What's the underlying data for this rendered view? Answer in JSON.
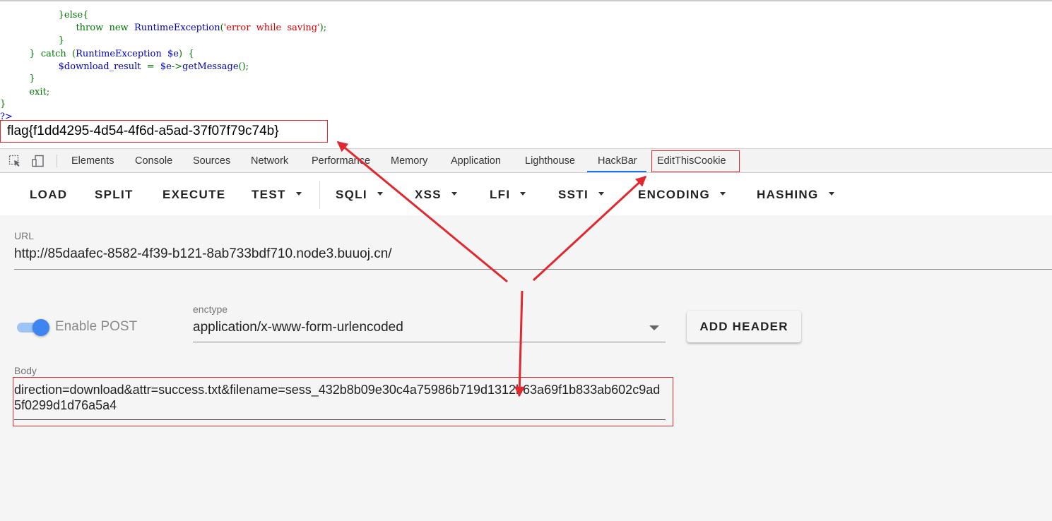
{
  "code": {
    "lines": [
      {
        "indent": "                    ",
        "text": "}else{",
        "color": "green"
      },
      {
        "indent": "                          ",
        "tokens": [
          {
            "t": "throw",
            "c": "green"
          },
          {
            "t": "  ",
            "c": "green"
          },
          {
            "t": "new",
            "c": "green"
          },
          {
            "t": "  ",
            "c": "green"
          },
          {
            "t": "RuntimeException",
            "c": "blue"
          },
          {
            "t": "(",
            "c": "green"
          },
          {
            "t": "'error  while  saving'",
            "c": "red"
          },
          {
            "t": ");",
            "c": "green"
          }
        ]
      },
      {
        "indent": "                    ",
        "text": "}",
        "color": "green"
      },
      {
        "indent": "          ",
        "tokens": [
          {
            "t": "}  catch  (",
            "c": "green"
          },
          {
            "t": "RuntimeException  $e",
            "c": "blue"
          },
          {
            "t": ")  {",
            "c": "green"
          }
        ]
      },
      {
        "indent": "                    ",
        "tokens": [
          {
            "t": "$download_result",
            "c": "blue"
          },
          {
            "t": "  =  ",
            "c": "green"
          },
          {
            "t": "$e",
            "c": "blue"
          },
          {
            "t": "->",
            "c": "green"
          },
          {
            "t": "getMessage",
            "c": "blue"
          },
          {
            "t": "();",
            "c": "green"
          }
        ]
      },
      {
        "indent": "          ",
        "text": "}",
        "color": "green"
      },
      {
        "indent": "          ",
        "text": "exit;",
        "color": "green"
      },
      {
        "indent": "",
        "text": "}",
        "color": "green"
      },
      {
        "indent": "",
        "text": "?>",
        "color": "blue"
      }
    ],
    "flag": "flag{f1dd4295-4d54-4f6d-a5ad-37f07f79c74b}"
  },
  "devtools": {
    "tabs": [
      "Elements",
      "Console",
      "Sources",
      "Network",
      "Performance",
      "Memory",
      "Application",
      "Lighthouse",
      "HackBar",
      "EditThisCookie"
    ],
    "active_tab": "HackBar",
    "icons": [
      "inspect-element-icon",
      "device-toolbar-icon"
    ]
  },
  "hackbar": {
    "toolbar": {
      "load": "LOAD",
      "split": "SPLIT",
      "execute": "EXECUTE",
      "test": "TEST",
      "sqli": "SQLI",
      "xss": "XSS",
      "lfi": "LFI",
      "ssti": "SSTI",
      "encoding": "ENCODING",
      "hashing": "HASHING"
    },
    "url_label": "URL",
    "url_value": "http://85daafec-8582-4f39-b121-8ab733bdf710.node3.buuoj.cn/",
    "enable_post_label": "Enable POST",
    "enable_post_on": true,
    "enctype_label": "enctype",
    "enctype_value": "application/x-www-form-urlencoded",
    "add_header_label": "ADD HEADER",
    "body_label": "Body",
    "body_value": "direction=download&attr=success.txt&filename=sess_432b8b09e30c4a75986b719d1312b63a69f1b833ab602c9ad5f0299d1d76a5a4"
  },
  "colors": {
    "annotation_red": "#e0282e",
    "accent_blue": "#1a73e8",
    "toggle_blue": "#3d85f0",
    "php_green": "#007700",
    "php_blue": "#0000bb",
    "php_red": "#dd0000"
  }
}
